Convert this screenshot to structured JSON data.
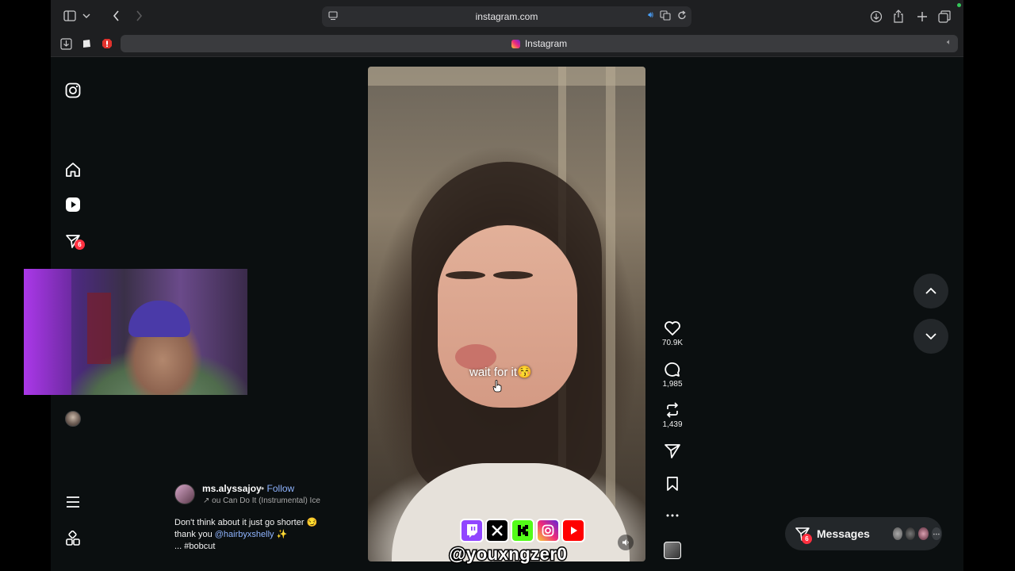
{
  "browser": {
    "url": "instagram.com",
    "tab_title": "Instagram"
  },
  "sidebar": {
    "notifications_badge": "6"
  },
  "reel": {
    "overlay_text": "wait for it😚",
    "likes": "70.9K",
    "comments": "1,985",
    "reposts": "1,439",
    "username": "ms.alyssajoy",
    "follow_label": "Follow",
    "dot": "•",
    "audio": "ou Can Do It (Instrumental)  Ice",
    "caption_line1": "Don't think about it just go shorter 😏",
    "caption_prefix": "thank you ",
    "caption_mention": "@hairbyxshelly",
    "caption_suffix": " ✨",
    "caption_line3": "... #bobcut"
  },
  "messages": {
    "label": "Messages",
    "badge": "6"
  },
  "stream_overlay": {
    "handle": "@youxngzer0"
  },
  "colors": {
    "accent_link": "#8fb4ff",
    "badge_red": "#ff3040",
    "background": "#0b0f10"
  }
}
